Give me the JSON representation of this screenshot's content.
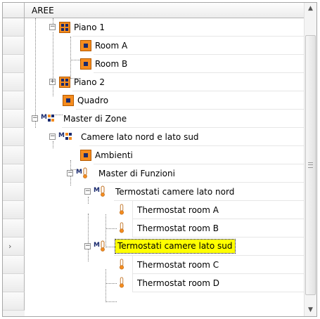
{
  "grid": {
    "column_header": "AREE"
  },
  "tree": [
    {
      "label": "Piano 1",
      "icon": "floor-grid-icon",
      "expander": "−"
    },
    {
      "label": "Room A",
      "icon": "room-icon"
    },
    {
      "label": "Room B",
      "icon": "room-icon"
    },
    {
      "label": "Piano 2",
      "icon": "floor-grid-icon",
      "expander": "+"
    },
    {
      "label": "Quadro",
      "icon": "room-icon"
    },
    {
      "label": "Master di Zone",
      "icon": "master-zone-icon",
      "expander": "−"
    },
    {
      "label": "Camere lato nord e lato sud",
      "icon": "master-zone-icon",
      "expander": "−"
    },
    {
      "label": "Ambienti",
      "icon": "room-icon"
    },
    {
      "label": "Master di Funzioni",
      "icon": "master-function-icon",
      "expander": "−"
    },
    {
      "label": "Termostati camere lato nord",
      "icon": "master-function-icon",
      "expander": "−"
    },
    {
      "label": "Thermostat room A",
      "icon": "thermostat-icon"
    },
    {
      "label": "Thermostat room B",
      "icon": "thermostat-icon"
    },
    {
      "label": "Termostati camere lato sud",
      "icon": "master-function-icon",
      "expander": "−",
      "selected": true
    },
    {
      "label": "Thermostat room C",
      "icon": "thermostat-icon"
    },
    {
      "label": "Thermostat room D",
      "icon": "thermostat-icon"
    }
  ],
  "row_indicator": "›",
  "scrollbar": {
    "up": "▲",
    "down": "▼"
  },
  "colors": {
    "selected_bg": "#ffff00",
    "icon_orange": "#f58c1e",
    "icon_navy": "#1a2a6e"
  }
}
